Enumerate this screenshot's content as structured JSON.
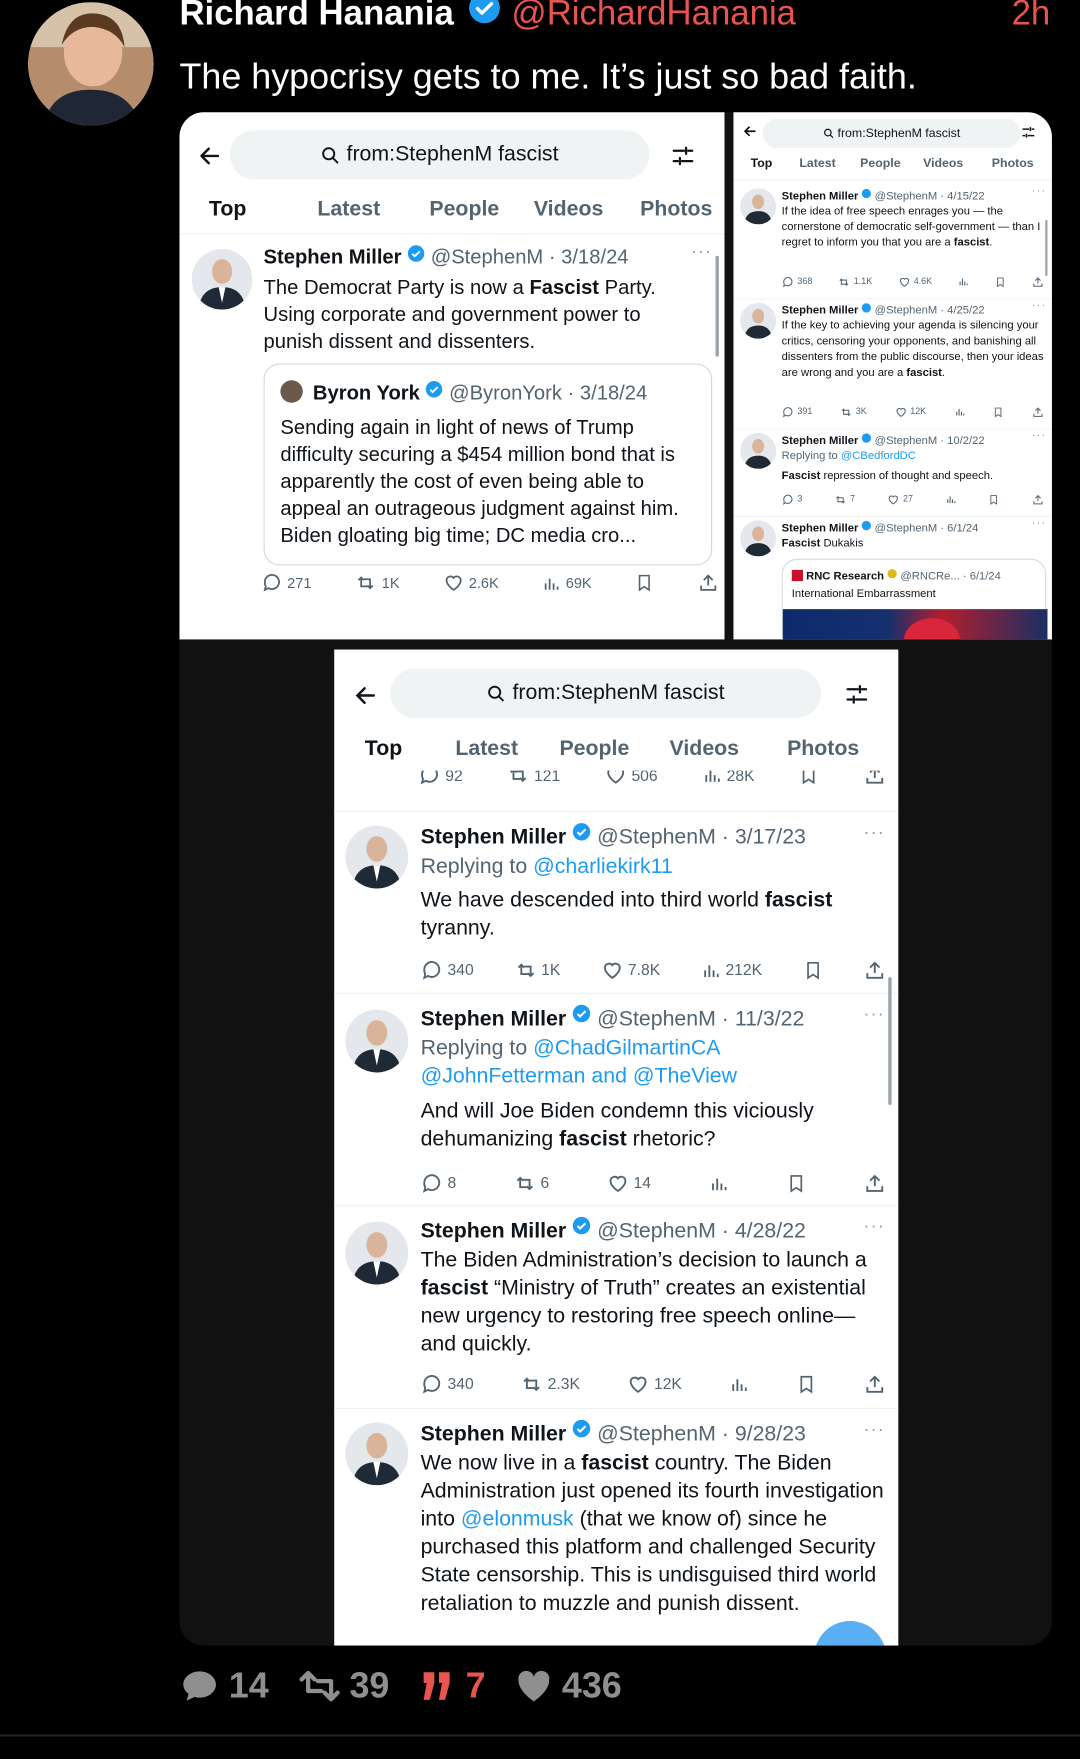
{
  "post": {
    "author_name": "Richard Hanania",
    "author_handle": "@RichardHanania",
    "time": "2h",
    "text": "The hypocrisy gets to me. It’s just so bad faith."
  },
  "search_query": "from:StephenM fascist",
  "tabs": [
    "Top",
    "Latest",
    "People",
    "Videos",
    "Photos"
  ],
  "shot1": {
    "tweet": {
      "name": "Stephen Miller",
      "handle_date": "@StephenM · 3/18/24",
      "text_a": "The Democrat Party is now a ",
      "bold": "Fascist",
      "text_b": " Party. Using corporate and government power to punish dissent and dissenters."
    },
    "quote": {
      "name": "Byron York",
      "handle_date": "@ByronYork · 3/18/24",
      "text": "Sending again in light of news of Trump difficulty securing a $454 million bond that is apparently the cost of even being able to appeal an outrageous judgment against him. Biden gloating big time; DC media cro..."
    },
    "stats": {
      "replies": "271",
      "reposts": "1K",
      "likes": "2.6K",
      "views": "69K"
    }
  },
  "shot2": {
    "t1": {
      "name": "Stephen Miller",
      "hd": "@StephenM · 4/15/22",
      "text_a": "If the idea of free speech enrages you — the cornerstone of democratic self-government — than I regret to inform you that you are a ",
      "bold": "fascist",
      "text_b": ".",
      "r": "368",
      "rt": "1.1K",
      "l": "4.6K"
    },
    "t2": {
      "name": "Stephen Miller",
      "hd": "@StephenM · 4/25/22",
      "text_a": "If the key to achieving your agenda is silencing your critics, censoring your opponents, and banishing all dissenters from the public discourse, then your ideas are wrong and you are a ",
      "bold": "fascist",
      "text_b": ".",
      "r": "391",
      "rt": "3K",
      "l": "12K"
    },
    "t3": {
      "name": "Stephen Miller",
      "hd": "@StephenM · 10/2/22",
      "replying": "Replying to ",
      "reply_to": "@CBedfordDC",
      "bold": "Fascist",
      "text_b": " repression of thought and speech.",
      "r": "3",
      "rt": "7",
      "l": "27"
    },
    "t4": {
      "name": "Stephen Miller",
      "hd": "@StephenM · 6/1/24",
      "bold": "Fascist",
      "text_b": " Dukakis"
    },
    "q4": {
      "name": "RNC Research",
      "hd": "@RNCRe... · 6/1/24",
      "text": "International Embarrassment"
    }
  },
  "shot3": {
    "partial_stats": {
      "r": "92",
      "rt": "121",
      "l": "506",
      "v": "28K"
    },
    "t1": {
      "name": "Stephen Miller",
      "hd": "@StephenM · 3/17/23",
      "replying": "Replying to ",
      "reply_to": "@charliekirk11",
      "text_a": "We have descended into third world ",
      "bold": "fascist",
      "text_b": " tyranny.",
      "r": "340",
      "rt": "1K",
      "l": "7.8K",
      "v": "212K"
    },
    "t2": {
      "name": "Stephen Miller",
      "hd": "@StephenM · 11/3/22",
      "replying": "Replying to ",
      "reply_to": "@ChadGilmartinCA",
      "reply_to2": "@JohnFetterman and @TheView",
      "text_a": "And will Joe Biden condemn this viciously dehumanizing ",
      "bold": "fascist",
      "text_b": " rhetoric?",
      "r": "8",
      "rt": "6",
      "l": "14"
    },
    "t3": {
      "name": "Stephen Miller",
      "hd": "@StephenM · 4/28/22",
      "text_a": "The Biden Administration’s decision to launch a ",
      "bold": "fascist",
      "text_b": " “Ministry of Truth” creates an existential new urgency to restoring free speech online—and quickly.",
      "r": "340",
      "rt": "2.3K",
      "l": "12K"
    },
    "t4": {
      "name": "Stephen Miller",
      "hd": "@StephenM · 9/28/23",
      "text_a": "We now live in a ",
      "bold": "fascist",
      "text_b": " country. The Biden Administration just opened its fourth investigation into ",
      "mention": "@elonmusk",
      "text_c": " (that we know of) since he purchased this platform and challenged Security State censorship. This is undisguised third world retaliation to muzzle and punish dissent."
    }
  },
  "footer": {
    "replies": "14",
    "reposts": "39",
    "quotes": "7",
    "likes": "436"
  },
  "colors": {
    "accent": "#e8544f",
    "twitter_blue": "#1d9bf0",
    "background": "#000000"
  },
  "icons": [
    "verified-badge-icon",
    "back-arrow-icon",
    "search-icon",
    "filter-sliders-icon",
    "reply-icon",
    "repost-icon",
    "like-icon",
    "views-icon",
    "bookmark-icon",
    "share-icon",
    "more-icon",
    "comment-icon",
    "quote-icon",
    "heart-icon"
  ]
}
